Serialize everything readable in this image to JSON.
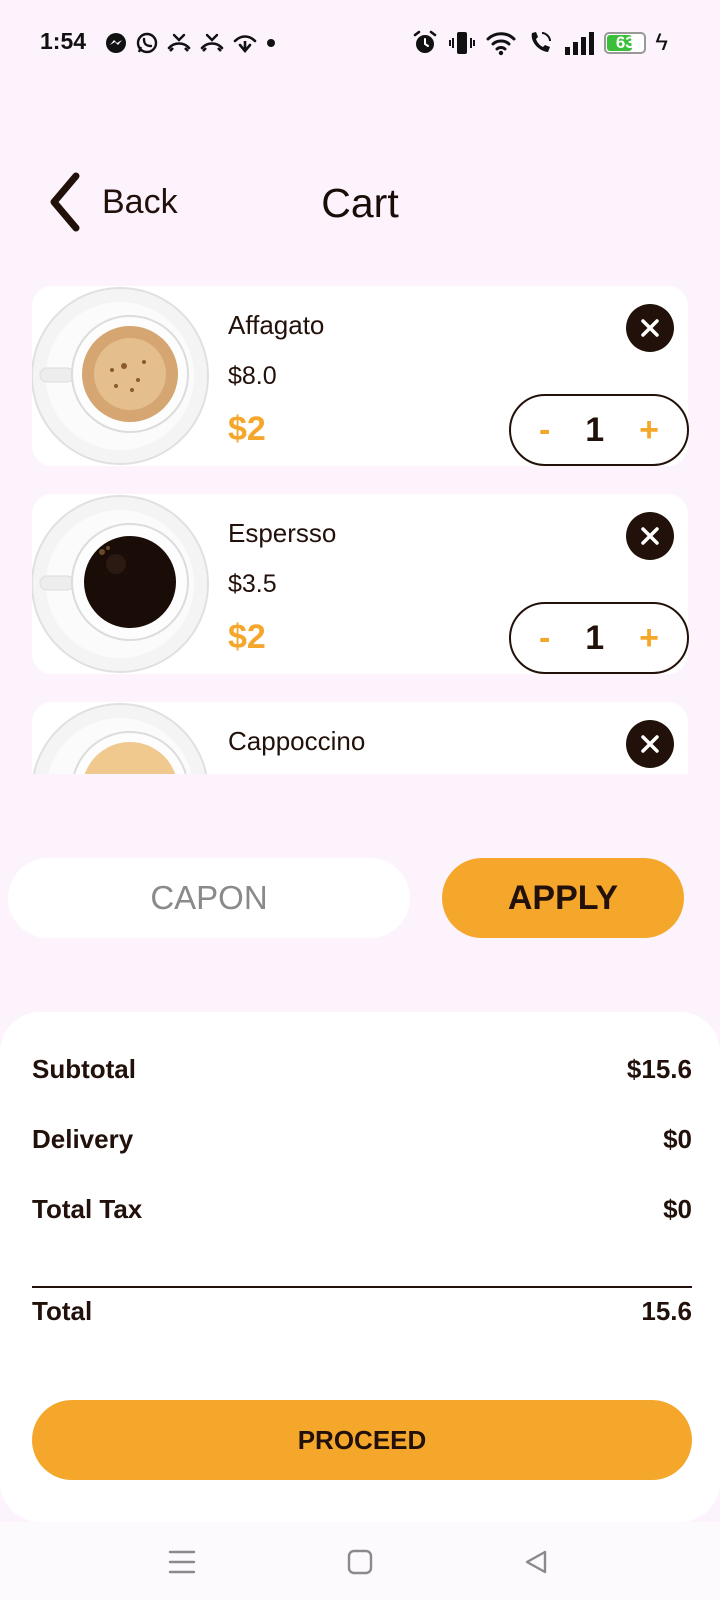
{
  "status_bar": {
    "time": "1:54",
    "battery_level": "63",
    "left_icons": [
      "messenger-icon",
      "whatsapp-icon",
      "missed-call-icon",
      "missed-call-icon",
      "wifi-calling-icon",
      "dot-icon"
    ],
    "right_icons": [
      "alarm-icon",
      "vibrate-icon",
      "wifi-icon",
      "wifi-call-icon",
      "signal-icon",
      "battery-icon",
      "charging-icon"
    ]
  },
  "header": {
    "back_label": "Back",
    "title": "Cart"
  },
  "cart": {
    "items": [
      {
        "name": "Affagato",
        "price": "$8.0",
        "discount": "$2",
        "quantity": "1",
        "decrement": "-",
        "increment": "+",
        "image": "latte-cup"
      },
      {
        "name": "Espersso",
        "price": "$3.5",
        "discount": "$2",
        "quantity": "1",
        "decrement": "-",
        "increment": "+",
        "image": "espresso-cup"
      },
      {
        "name": "Cappoccino",
        "image": "cappuccino-cup"
      }
    ]
  },
  "coupon": {
    "placeholder": "CAPON",
    "apply_label": "APPLY"
  },
  "summary": {
    "subtotal_label": "Subtotal",
    "subtotal_value": "$15.6",
    "delivery_label": "Delivery",
    "delivery_value": "$0",
    "tax_label": "Total Tax",
    "tax_value": "$0",
    "total_label": "Total",
    "total_value": "15.6",
    "proceed_label": "PROCEED"
  },
  "colors": {
    "background": "#fcf3fd",
    "accent": "#f5a72c",
    "dark": "#22110a",
    "card": "#ffffff"
  },
  "nav": {
    "icons": [
      "menu-icon",
      "home-icon",
      "back-nav-icon"
    ]
  }
}
